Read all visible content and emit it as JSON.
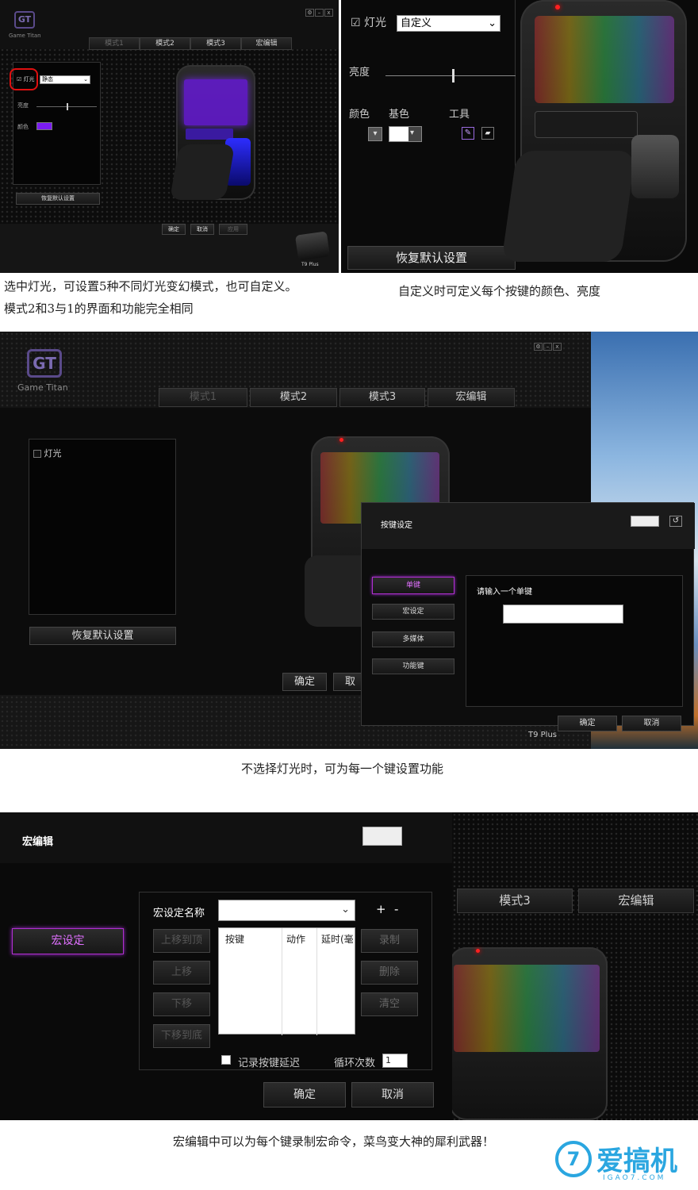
{
  "panel1": {
    "brand": "Game Titan",
    "tabs": [
      "模式1",
      "模式2",
      "模式3",
      "宏编辑"
    ],
    "light_label": "灯光",
    "mode_value": "静态",
    "brightness_label": "亮度",
    "color_label": "颜色",
    "reset_label": "恢复默认设置",
    "ok_label": "确定",
    "cancel_label": "取消",
    "apply_label": "应用",
    "model": "T9 Plus",
    "window_controls": [
      "⚙",
      "–",
      "x"
    ]
  },
  "panel2": {
    "light_label": "灯光",
    "mode_value": "自定义",
    "brightness_label": "亮度",
    "color_label": "颜色",
    "base_color_label": "基色",
    "tool_label": "工具",
    "reset_label": "恢复默认设置"
  },
  "caption1_line1": "选中灯光，可设置5种不同灯光变幻模式，也可自定义。",
  "caption1_line2": "模式2和3与1的界面和功能完全相同",
  "caption2": "自定义时可定义每个按键的颜色、亮度",
  "panel3": {
    "brand": "Game Titan",
    "tabs": [
      "模式1",
      "模式2",
      "模式3",
      "宏编辑"
    ],
    "light_label": "灯光",
    "reset_label": "恢复默认设置",
    "ok_label": "确定",
    "cancel_label": "取消",
    "model": "T9 Plus",
    "window_controls": [
      "⚙",
      "–",
      "x"
    ],
    "dialog": {
      "title": "按键设定",
      "side_buttons": [
        "单键",
        "宏设定",
        "多媒体",
        "功能键"
      ],
      "prompt": "请输入一个单键",
      "ok_label": "确定",
      "cancel_label": "取消"
    }
  },
  "caption3": "不选择灯光时，可为每一个键设置功能",
  "panel4": {
    "title": "宏编辑",
    "macro_side_button": "宏设定",
    "name_label": "宏设定名称",
    "plus": "+",
    "minus": "-",
    "table_headers": [
      "按键",
      "动作",
      "延时(毫"
    ],
    "left_buttons": [
      "上移到顶",
      "上移",
      "下移",
      "下移到底"
    ],
    "right_buttons": [
      "录制",
      "删除",
      "清空"
    ],
    "record_delay_label": "记录按键延迟",
    "loop_label": "循环次数",
    "loop_value": "1",
    "ok_label": "确定",
    "cancel_label": "取消",
    "bg_tabs": [
      "模式3",
      "宏编辑"
    ]
  },
  "caption4": "宏编辑中可以为每个键录制宏命令，菜鸟变大神的犀利武器！",
  "watermark": {
    "text": "爱搞机",
    "sub": "IGAO7.COM"
  },
  "colors": {
    "accent_purple": "#a02bd0",
    "red_highlight": "#e01010"
  }
}
